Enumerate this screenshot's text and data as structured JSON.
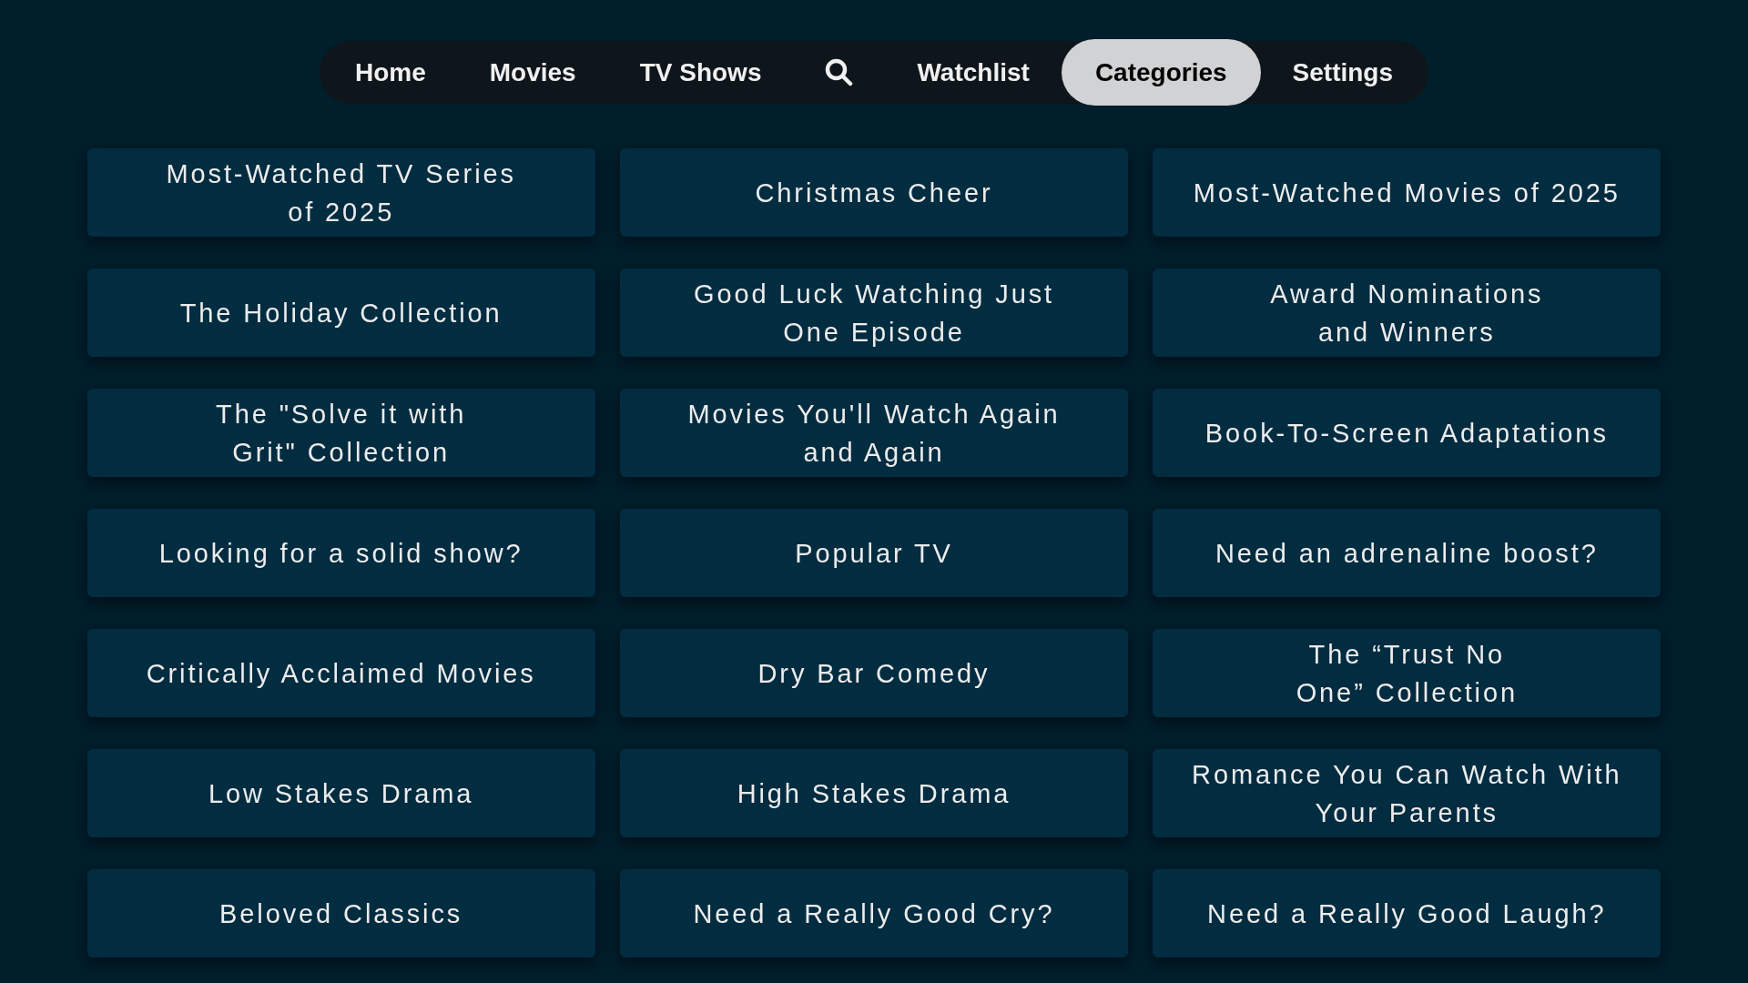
{
  "nav": {
    "items": [
      {
        "kind": "text",
        "label": "Home",
        "selected": false
      },
      {
        "kind": "text",
        "label": "Movies",
        "selected": false
      },
      {
        "kind": "text",
        "label": "TV Shows",
        "selected": false
      },
      {
        "kind": "search",
        "selected": false
      },
      {
        "kind": "text",
        "label": "Watchlist",
        "selected": false
      },
      {
        "kind": "text",
        "label": "Categories",
        "selected": true
      },
      {
        "kind": "text",
        "label": "Settings",
        "selected": false
      }
    ]
  },
  "categories": [
    {
      "title": "Most-Watched TV Series\nof 2025"
    },
    {
      "title": "Christmas Cheer"
    },
    {
      "title": "Most-Watched Movies of 2025"
    },
    {
      "title": "The Holiday Collection"
    },
    {
      "title": "Good Luck Watching Just\nOne Episode"
    },
    {
      "title": "Award Nominations\nand Winners"
    },
    {
      "title": "The \"Solve it with\nGrit\" Collection"
    },
    {
      "title": "Movies You'll Watch Again\nand Again"
    },
    {
      "title": "Book-To-Screen Adaptations"
    },
    {
      "title": "Looking for a solid show?"
    },
    {
      "title": "Popular TV"
    },
    {
      "title": "Need an adrenaline boost?"
    },
    {
      "title": "Critically Acclaimed Movies"
    },
    {
      "title": "Dry Bar Comedy"
    },
    {
      "title": "The “Trust No\nOne” Collection"
    },
    {
      "title": "Low Stakes Drama"
    },
    {
      "title": "High Stakes Drama"
    },
    {
      "title": "Romance You Can Watch With\nYour Parents"
    },
    {
      "title": "Beloved Classics"
    },
    {
      "title": "Need a Really Good Cry?"
    },
    {
      "title": "Need a Really Good Laugh?"
    }
  ]
}
